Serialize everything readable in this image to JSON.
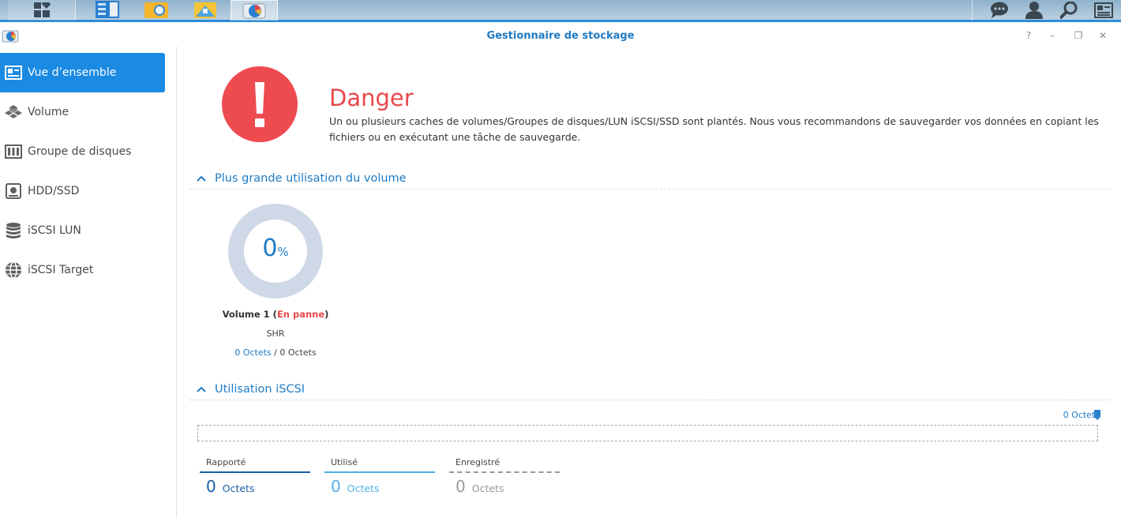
{
  "window": {
    "title": "Gestionnaire de stockage",
    "help_glyph": "?",
    "minimize_glyph": "–",
    "restore_glyph": "❐",
    "close_glyph": "✕"
  },
  "taskbar": {
    "icons": [
      "main-menu-icon",
      "control-panel-icon",
      "file-station-icon",
      "package-center-icon",
      "storage-manager-icon"
    ],
    "right_icons": [
      "notifications-icon",
      "user-icon",
      "search-icon",
      "widgets-icon"
    ]
  },
  "sidebar": {
    "items": [
      {
        "label": "Vue d’ensemble",
        "icon": "overview-icon",
        "active": true
      },
      {
        "label": "Volume",
        "icon": "volume-icon",
        "active": false
      },
      {
        "label": "Groupe de disques",
        "icon": "disk-group-icon",
        "active": false
      },
      {
        "label": "HDD/SSD",
        "icon": "hdd-icon",
        "active": false
      },
      {
        "label": "iSCSI LUN",
        "icon": "lun-icon",
        "active": false
      },
      {
        "label": "iSCSI Target",
        "icon": "target-icon",
        "active": false
      }
    ]
  },
  "status": {
    "title": "Danger",
    "message": "Un ou plusieurs caches de volumes/Groupes de disques/LUN iSCSI/SSD sont plantés. Nous vous recommandons de sauvegarder vos données en copiant les fichiers ou en exécutant une tâche de sauvegarde.",
    "color": "#ee4b50"
  },
  "volume_section": {
    "title": "Plus grande utilisation du volume",
    "volume": {
      "usage_value": "0",
      "usage_unit": "%",
      "usage_fraction": 0,
      "name": "Volume 1",
      "state": "En panne",
      "type": "SHR",
      "used": "0 Octets",
      "separator": "/",
      "total": "0 Octets"
    }
  },
  "iscsi_section": {
    "title": "Utilisation iSCSI",
    "bar_label": "0 Octets",
    "legend": [
      {
        "name": "Rapporté",
        "value": "0",
        "unit": "Octets",
        "color": "#1a5fa8"
      },
      {
        "name": "Utilisé",
        "value": "0",
        "unit": "Octets",
        "color": "#4fb0e6"
      },
      {
        "name": "Enregistré",
        "value": "0",
        "unit": "Octets",
        "color": "#999999"
      }
    ]
  },
  "colors": {
    "accent": "#1a8ae3",
    "link": "#1f7bc4",
    "danger": "#e8484c",
    "donut_track": "#cfd8e6"
  }
}
